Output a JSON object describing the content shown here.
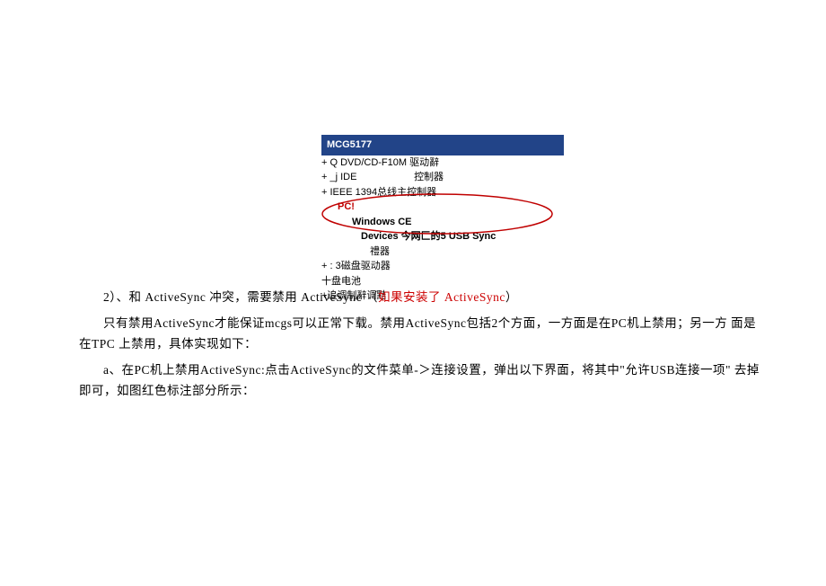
{
  "device_tree": {
    "header": "MCG5177",
    "items": [
      "+ Q DVD/CD-F10M 驱动辭",
      "+ _j IDE",
      "控制器",
      "+ IEEE 1394总线主控制器",
      "PC!",
      "Windows CE",
      "Devices 今网匚的5 USB Sync",
      "禮器",
      "+ : 3磁盘驱动器",
      "十盘电池",
      "+追调制辭调黠"
    ]
  },
  "section": {
    "heading_prefix": "2）、和 ActiveSync 冲突，需要禁用 ActiveSync （",
    "heading_red": "如果安装了 ActiveSync",
    "heading_suffix": "）",
    "para1": "只有禁用ActiveSync才能保证mcgs可以正常下载。禁用ActiveSync包括2个方面，一方面是在PC机上禁用；另一方 面是在TPC 上禁用，具体实现如下：",
    "para2": "a、在PC机上禁用ActiveSync:点击ActiveSync的文件菜单-＞连接设置，弹出以下界面，将其中\"允许USB连接一项\" 去掉即可，如图红色标注部分所示："
  }
}
